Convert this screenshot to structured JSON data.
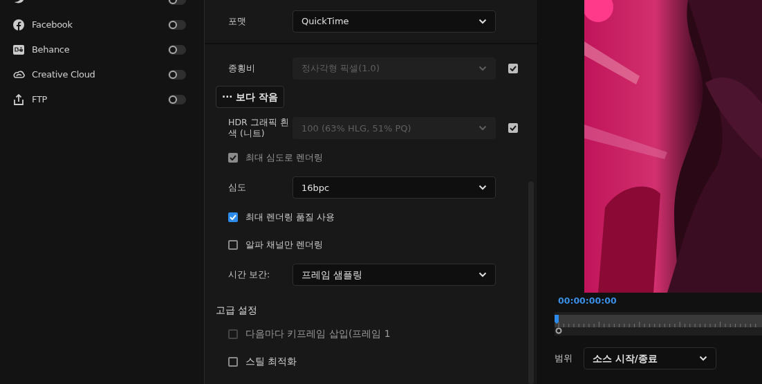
{
  "sidebar": {
    "items": [
      {
        "on": false
      },
      {
        "label": "Facebook",
        "on": false
      },
      {
        "label": "Behance",
        "on": false
      },
      {
        "label": "Creative Cloud",
        "on": false
      },
      {
        "label": "FTP",
        "on": false
      }
    ]
  },
  "format": {
    "label": "포맷",
    "value": "QuickTime"
  },
  "options": [
    {
      "kind": "select",
      "label": "종횡비",
      "value": "정사각형 픽셀(1.0)",
      "disabled": true,
      "checked": true
    },
    {
      "kind": "button",
      "label": "··· 보다 작음"
    },
    {
      "kind": "select",
      "label": "HDR 그래픽 흰색 (니트)",
      "value": "100 (63% HLG, 51% PQ)",
      "disabled": true,
      "checked": true
    },
    {
      "kind": "checkbox",
      "label": "최대 심도로 렌더링",
      "checked": true,
      "disabled": true
    },
    {
      "kind": "select",
      "label": "심도",
      "value": "16bpc",
      "disabled": false
    },
    {
      "kind": "checkbox",
      "label": "최대 렌더링 품질 사용",
      "checked": true,
      "disabled": false
    },
    {
      "kind": "checkbox",
      "label": "알파 채널만 렌더링",
      "checked": false,
      "disabled": false
    },
    {
      "kind": "select",
      "label": "시간 보간:",
      "value": "프레임 샘플링",
      "disabled": false
    },
    {
      "kind": "heading",
      "label": "고급 설정"
    },
    {
      "kind": "checkbox",
      "label": "다음마다 키프레임 삽입(프레임 1",
      "checked": false,
      "disabled": true
    },
    {
      "kind": "checkbox",
      "label": "스틸 최적화",
      "checked": false,
      "disabled": false
    }
  ],
  "preview": {
    "kind": "picture",
    "timecode": "00:00:00:00"
  },
  "range": {
    "label": "범위",
    "value": "소스 시작/종료"
  }
}
